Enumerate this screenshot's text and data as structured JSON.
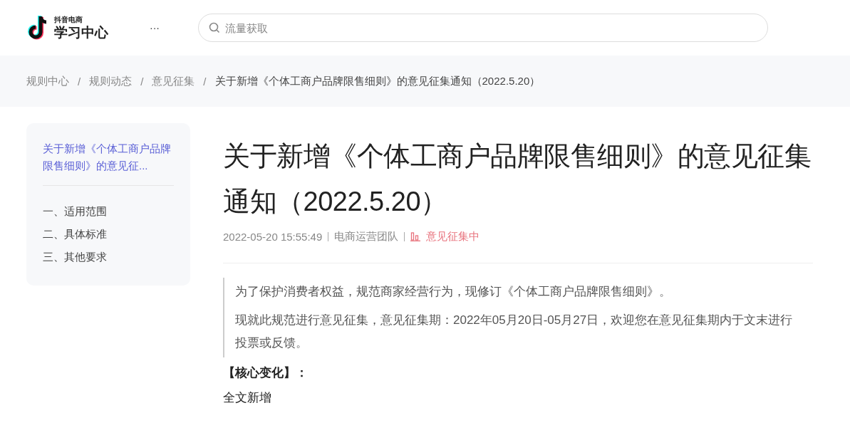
{
  "header": {
    "logo_small": "抖音电商",
    "logo_title": "学习中心",
    "more": "···",
    "search": {
      "placeholder": "流量获取"
    }
  },
  "breadcrumb": [
    "规则中心",
    "规则动态",
    "意见征集",
    "关于新增《个体工商户品牌限售细则》的意见征集通知（2022.5.20）"
  ],
  "breadcrumb_separator": "/",
  "toc": {
    "title": "关于新增《个体工商户品牌限售细则》的意见征...",
    "items": [
      "一、适用范围",
      "二、具体标准",
      "三、其他要求"
    ]
  },
  "article": {
    "title": "关于新增《个体工商户品牌限售细则》的意见征集通知（2022.5.20）",
    "date": "2022-05-20 15:55:49",
    "author": "电商运营团队",
    "status": "意见征集中",
    "quote": [
      "为了保护消费者权益，规范商家经营行为，现修订《个体工商户品牌限售细则》。",
      "现就此规范进行意见征集，意见征集期：2022年05月20日-05月27日，欢迎您在意见征集期内于文末进行投票或反馈。"
    ],
    "heading": "【核心变化】：",
    "body": "全文新增"
  }
}
